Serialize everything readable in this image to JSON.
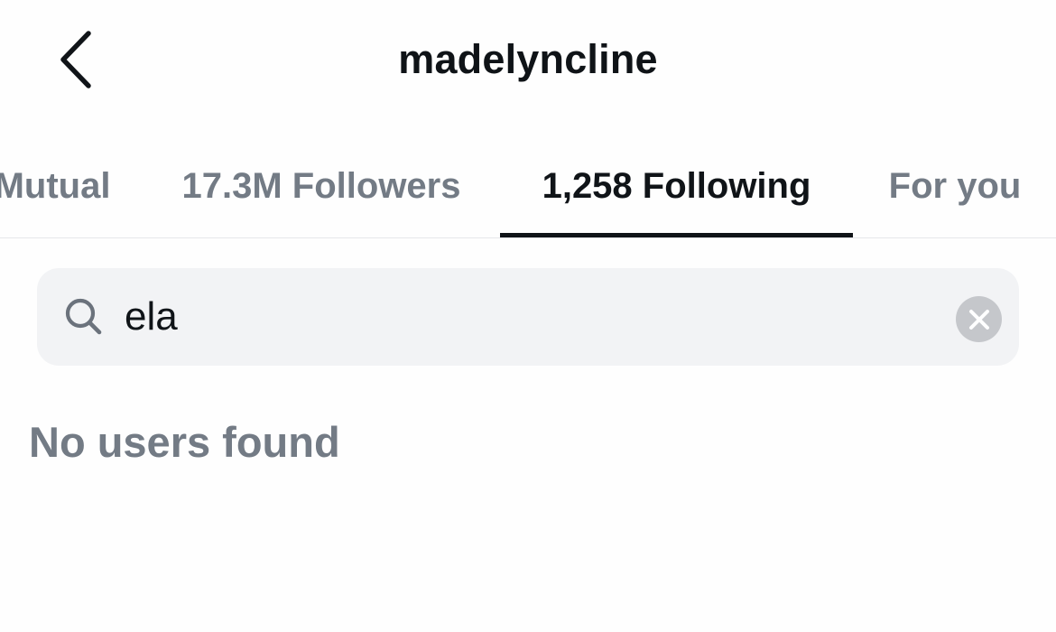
{
  "header": {
    "title": "madelyncline",
    "back_icon": "chevron-left-icon"
  },
  "tabs": [
    {
      "label": "Mutual",
      "active": false
    },
    {
      "label": "17.3M Followers",
      "active": false
    },
    {
      "label": "1,258 Following",
      "active": true
    },
    {
      "label": "For you",
      "active": false
    }
  ],
  "search": {
    "value": "ela",
    "icon": "search-icon",
    "clear_icon": "close-icon"
  },
  "results": {
    "empty_message": "No users found"
  },
  "colors": {
    "text_primary": "#101418",
    "text_secondary": "#737b85",
    "search_background": "#f2f3f5",
    "clear_button": "#c5c7cb"
  }
}
